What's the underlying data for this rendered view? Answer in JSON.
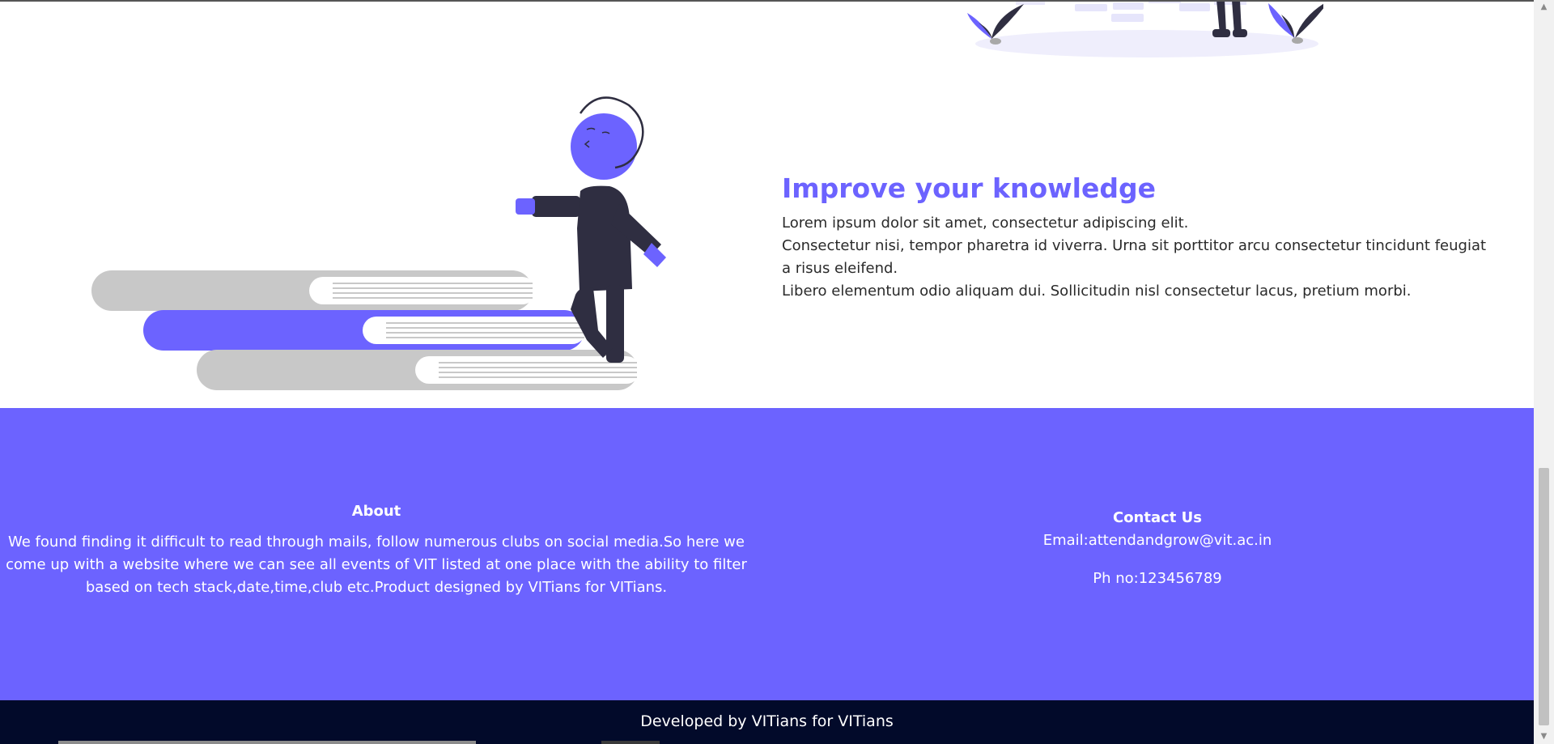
{
  "knowledge": {
    "title": "Improve your knowledge",
    "lines": [
      "Lorem ipsum dolor sit amet, consectetur adipiscing elit.",
      "Consectetur nisi, tempor pharetra id viverra. Urna sit porttitor arcu consectetur tincidunt feugiat a risus eleifend.",
      "Libero elementum odio aliquam dui. Sollicitudin nisl consectetur lacus, pretium morbi."
    ]
  },
  "footer": {
    "about_title": "About",
    "about_text": "We found finding it difficult to read through mails, follow numerous clubs on social media.So here we come up with a website where we can see all events of VIT listed at one place with the ability to filter based on tech stack,date,time,club etc.Product designed by VITians for VITians.",
    "contact_title": "Contact Us",
    "email": "Email:attendandgrow@vit.ac.in",
    "phone": "Ph no:123456789"
  },
  "bottom_bar": {
    "credit": "Developed by VITians for VITians"
  },
  "scrollbar": {
    "arrow_up": "▲",
    "arrow_down": "▼"
  },
  "colors": {
    "accent": "#6c63ff",
    "dark": "#2f2e41",
    "bottom_bar": "#020a2a",
    "book_gray": "#c8c8c8"
  },
  "icons": [
    "person-stepping-illustration",
    "books-stairs-illustration",
    "plants-illustration"
  ]
}
